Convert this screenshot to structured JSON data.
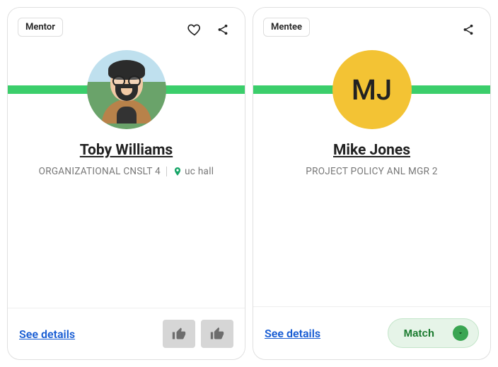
{
  "cards": [
    {
      "badge": "Mentor",
      "name": "Toby Williams",
      "title": "ORGANIZATIONAL CNSLT 4",
      "location": "uc hall",
      "see_details": "See details"
    },
    {
      "badge": "Mentee",
      "initials": "MJ",
      "name": "Mike Jones",
      "title": "PROJECT POLICY ANL MGR 2",
      "see_details": "See details",
      "match_label": "Match"
    }
  ]
}
